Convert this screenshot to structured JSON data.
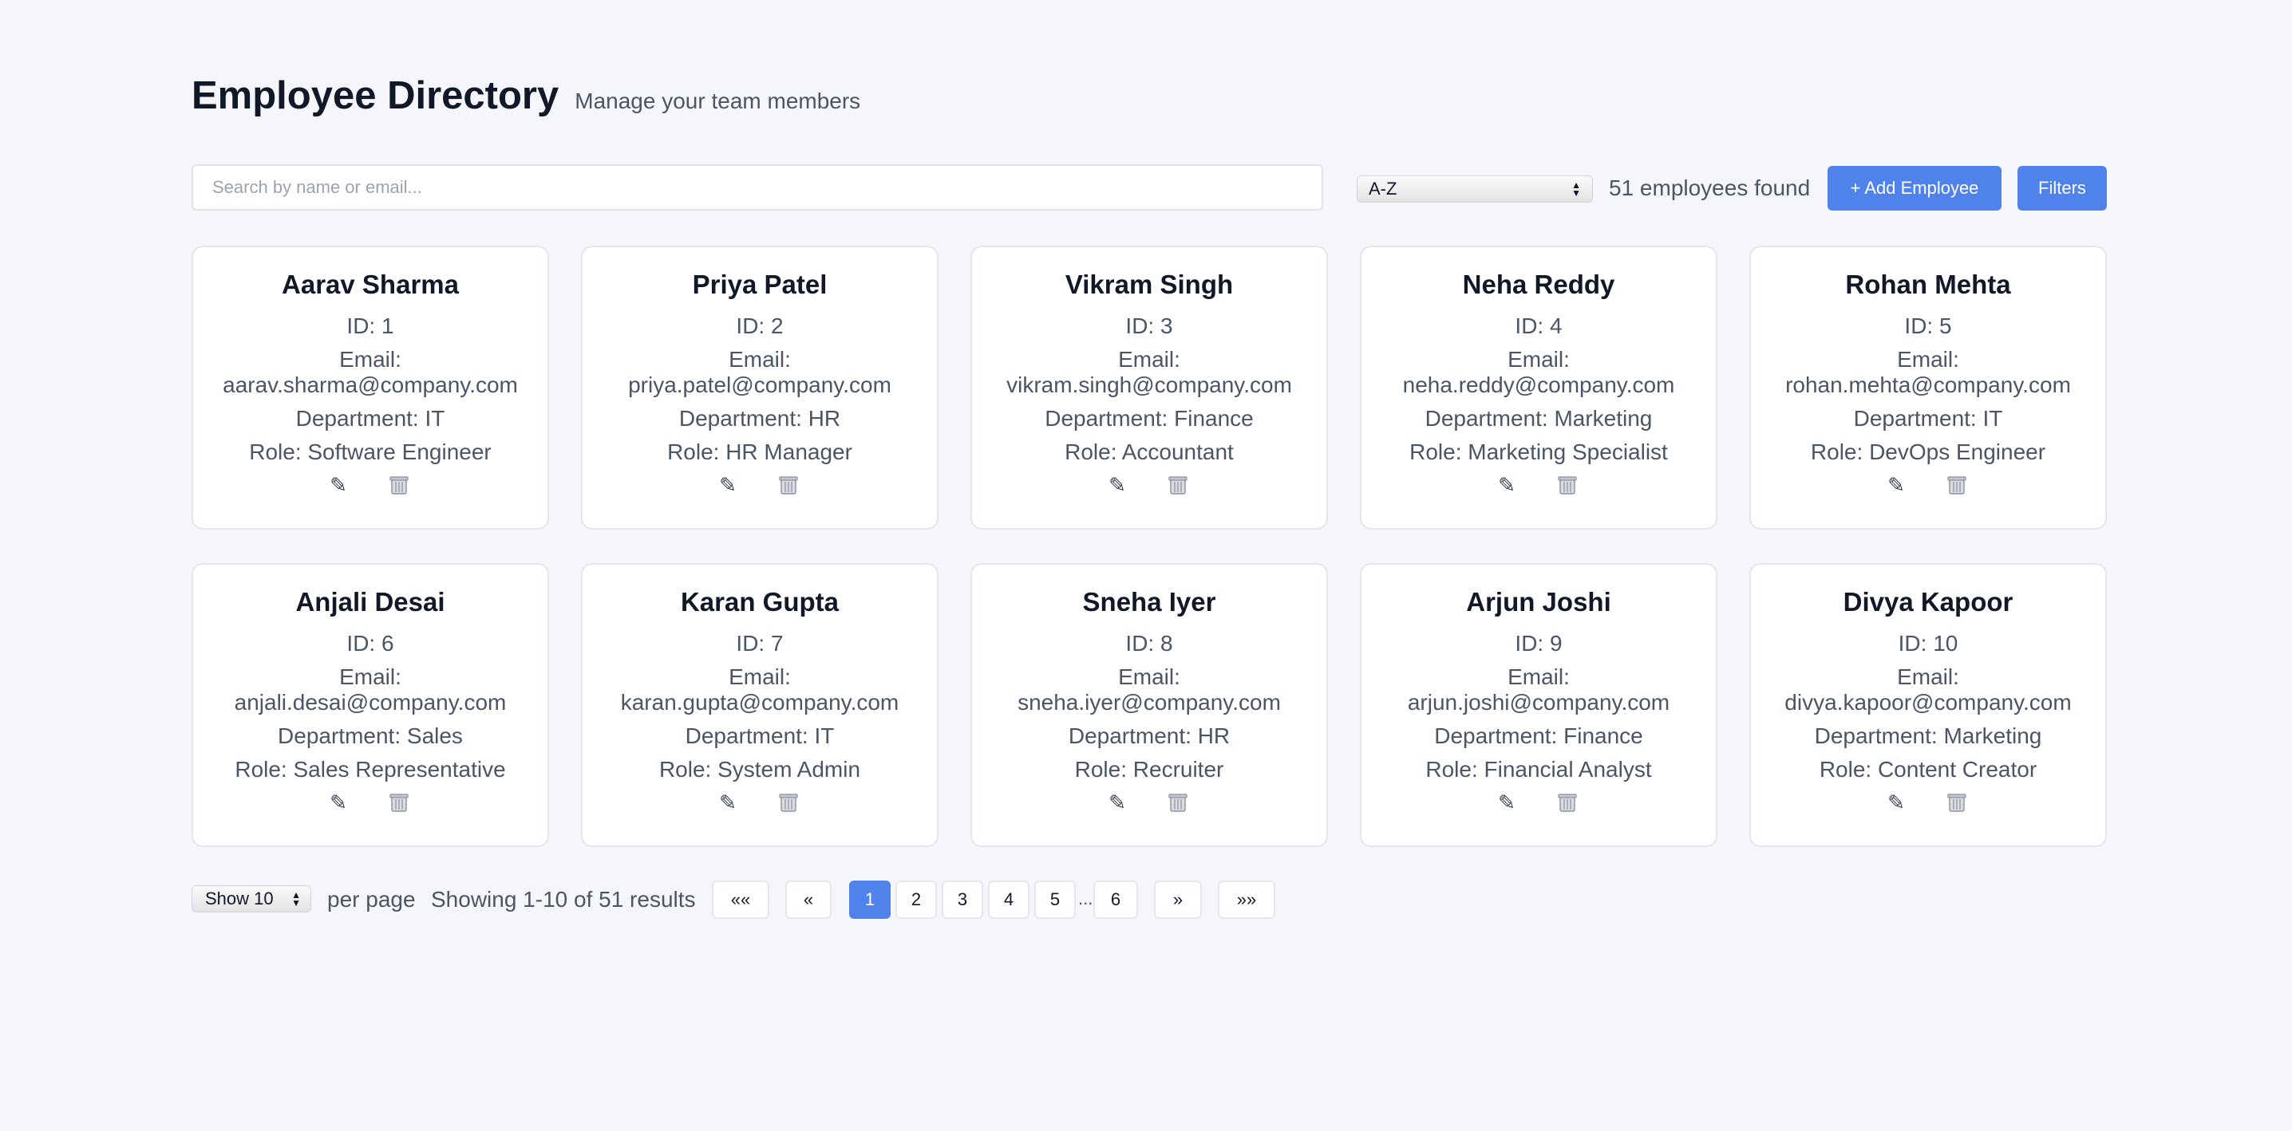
{
  "header": {
    "title": "Employee Directory",
    "subtitle": "Manage your team members"
  },
  "toolbar": {
    "search_placeholder": "Search by name or email...",
    "sort_value": "A-Z",
    "count_text": "51 employees found",
    "add_label": "+ Add Employee",
    "filters_label": "Filters"
  },
  "icons": {
    "edit": "✎",
    "delete": "trash-icon"
  },
  "employees": [
    {
      "name": "Aarav Sharma",
      "id": "ID: 1",
      "email_label": "Email:",
      "email": "aarav.sharma@company.com",
      "department": "Department: IT",
      "role": "Role: Software Engineer"
    },
    {
      "name": "Priya Patel",
      "id": "ID: 2",
      "email_label": "Email:",
      "email": "priya.patel@company.com",
      "department": "Department: HR",
      "role": "Role: HR Manager"
    },
    {
      "name": "Vikram Singh",
      "id": "ID: 3",
      "email_label": "Email:",
      "email": "vikram.singh@company.com",
      "department": "Department: Finance",
      "role": "Role: Accountant"
    },
    {
      "name": "Neha Reddy",
      "id": "ID: 4",
      "email_label": "Email:",
      "email": "neha.reddy@company.com",
      "department": "Department: Marketing",
      "role": "Role: Marketing Specialist"
    },
    {
      "name": "Rohan Mehta",
      "id": "ID: 5",
      "email_label": "Email:",
      "email": "rohan.mehta@company.com",
      "department": "Department: IT",
      "role": "Role: DevOps Engineer"
    },
    {
      "name": "Anjali Desai",
      "id": "ID: 6",
      "email_label": "Email:",
      "email": "anjali.desai@company.com",
      "department": "Department: Sales",
      "role": "Role: Sales Representative"
    },
    {
      "name": "Karan Gupta",
      "id": "ID: 7",
      "email_label": "Email:",
      "email": "karan.gupta@company.com",
      "department": "Department: IT",
      "role": "Role: System Admin"
    },
    {
      "name": "Sneha Iyer",
      "id": "ID: 8",
      "email_label": "Email:",
      "email": "sneha.iyer@company.com",
      "department": "Department: HR",
      "role": "Role: Recruiter"
    },
    {
      "name": "Arjun Joshi",
      "id": "ID: 9",
      "email_label": "Email:",
      "email": "arjun.joshi@company.com",
      "department": "Department: Finance",
      "role": "Role: Financial Analyst"
    },
    {
      "name": "Divya Kapoor",
      "id": "ID: 10",
      "email_label": "Email:",
      "email": "divya.kapoor@company.com",
      "department": "Department: Marketing",
      "role": "Role: Content Creator"
    }
  ],
  "pagination": {
    "per_page_value": "Show 10",
    "per_page_label": "per page",
    "showing_text": "Showing 1-10 of 51 results",
    "first": "«« ",
    "prev": "«",
    "pages": [
      "1",
      "2",
      "3",
      "4",
      "5"
    ],
    "ellipsis": "...",
    "last_page": "6",
    "next": "»",
    "last": "»»",
    "current_page": "1"
  },
  "colors": {
    "accent": "#4f82ea",
    "background": "#f5f6f9",
    "card": "#ffffff"
  }
}
